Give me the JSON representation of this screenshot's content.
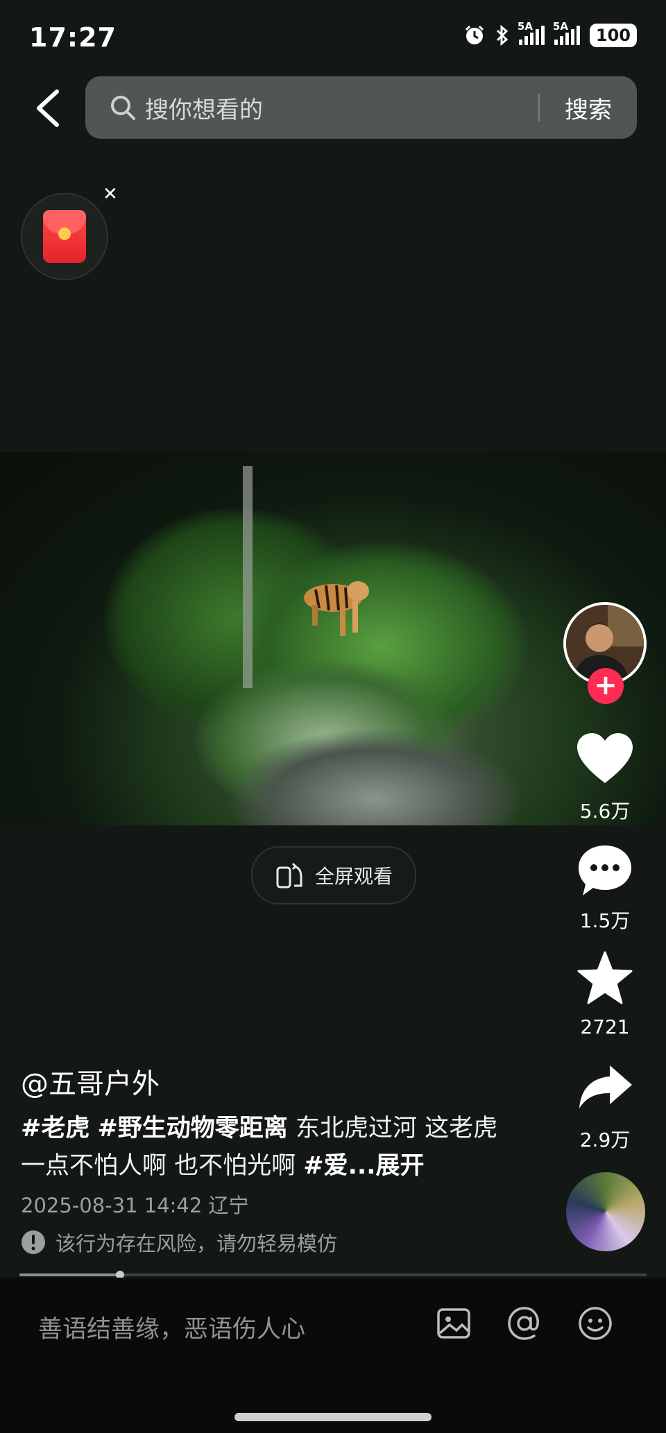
{
  "status_bar": {
    "time": "17:27",
    "signal_1_label": "5A",
    "signal_2_label": "5A",
    "battery": "100"
  },
  "search": {
    "placeholder": "搜你想看的",
    "button_label": "搜索"
  },
  "video": {
    "fullscreen_label": "全屏观看"
  },
  "actions": {
    "likes": "5.6万",
    "comments": "1.5万",
    "favorites": "2721",
    "shares": "2.9万"
  },
  "post": {
    "author": "@五哥户外",
    "hashtag_1": "#老虎",
    "hashtag_2": "#野生动物零距离",
    "caption_text": "东北虎过河 这老虎一点不怕人啊 也不怕光啊",
    "hashtag_3": "#爱",
    "expand_label": "...展开",
    "date_location": "2025-08-31 14:42 辽宁",
    "risk_warning": "该行为存在风险，请勿轻易模仿"
  },
  "playback": {
    "progress": 0.16
  },
  "comment_bar": {
    "placeholder": "善语结善缘，恶语伤人心"
  },
  "icons": [
    "back-icon",
    "search-icon",
    "red-packet-icon",
    "close-icon",
    "fullscreen-icon",
    "heart-icon",
    "comment-icon",
    "star-icon",
    "share-icon",
    "image-icon",
    "at-icon",
    "emoji-icon",
    "warning-icon"
  ],
  "colors": {
    "accent": "#fe2c55",
    "background": "#141815"
  }
}
